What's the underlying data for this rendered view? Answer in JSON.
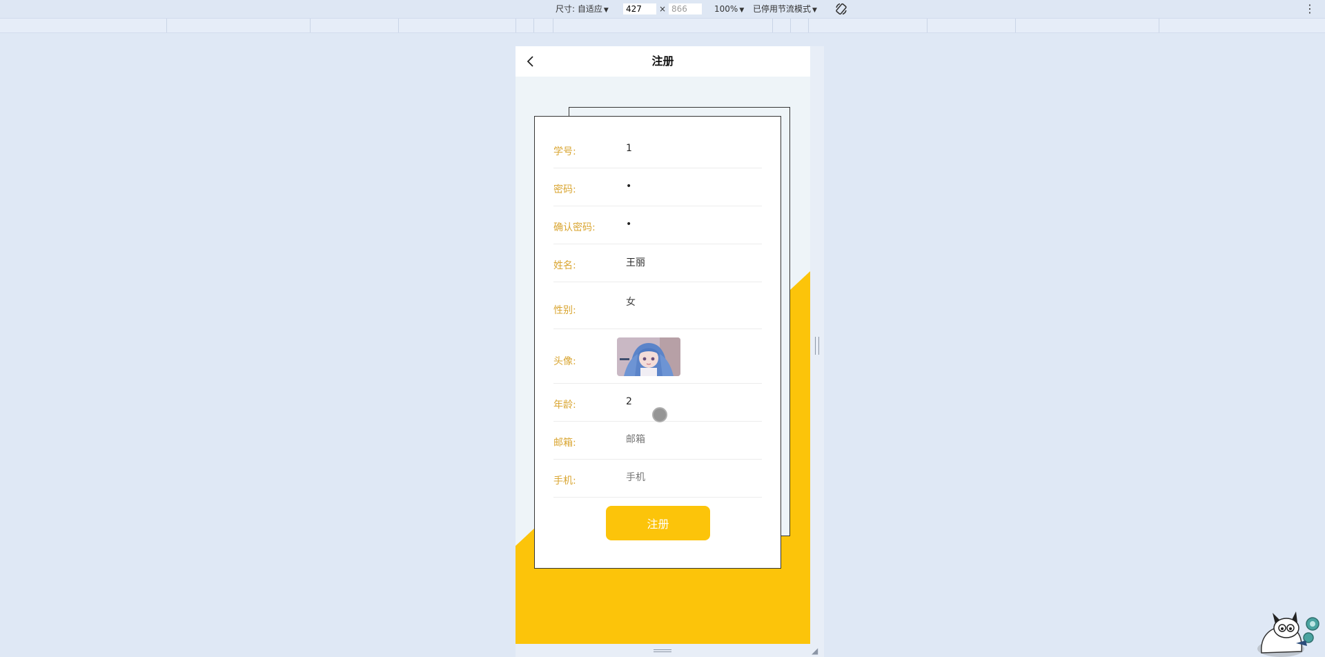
{
  "devtools": {
    "dimension_label": "尺寸: 自适应",
    "width": "427",
    "times": "×",
    "height": "866",
    "zoom": "100%",
    "throttle": "已停用节流模式",
    "more": "⋮"
  },
  "page": {
    "title": "注册",
    "fields": [
      {
        "label": "学号:",
        "value": "1",
        "placeholder": ""
      },
      {
        "label": "密码:",
        "value": "•",
        "placeholder": ""
      },
      {
        "label": "确认密码:",
        "value": "•",
        "placeholder": ""
      },
      {
        "label": "姓名:",
        "value": "王丽",
        "placeholder": ""
      },
      {
        "label": "性别:",
        "value": "女",
        "placeholder": ""
      },
      {
        "label": "头像:",
        "value": "",
        "placeholder": ""
      },
      {
        "label": "年龄:",
        "value": "2",
        "placeholder": ""
      },
      {
        "label": "邮箱:",
        "value": "",
        "placeholder": "邮箱"
      },
      {
        "label": "手机:",
        "value": "",
        "placeholder": "手机"
      }
    ],
    "submit_label": "注册"
  },
  "colors": {
    "accent": "#fcc40a",
    "label": "#d9a531",
    "background": "#eef4f8"
  },
  "icons": {
    "back": "chevron-left-icon",
    "rotate": "rotate-icon",
    "more": "more-vertical-icon"
  }
}
